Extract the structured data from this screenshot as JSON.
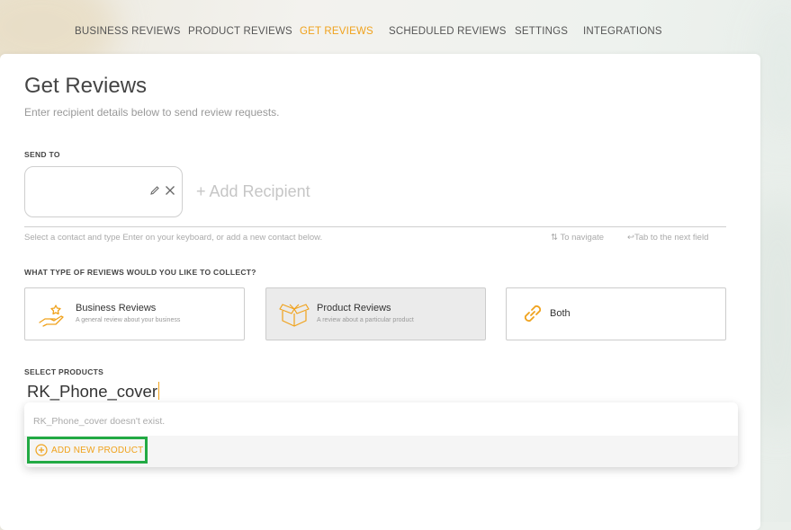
{
  "nav": {
    "items": [
      {
        "label": "BUSINESS REVIEWS",
        "active": false
      },
      {
        "label": "PRODUCT REVIEWS",
        "active": false
      },
      {
        "label": "GET REVIEWS",
        "active": true
      },
      {
        "label": "SCHEDULED REVIEWS",
        "active": false
      },
      {
        "label": "SETTINGS",
        "active": false
      },
      {
        "label": "INTEGRATIONS",
        "active": false
      }
    ]
  },
  "page": {
    "title": "Get Reviews",
    "subtitle": "Enter recipient details below to send review requests."
  },
  "send_to": {
    "label": "SEND TO",
    "add_recipient": "+ Add Recipient",
    "hint_left": "Select a contact and type Enter on your keyboard, or add a new contact below.",
    "hint_navigate": "To navigate",
    "hint_tab": "Tab to the next field"
  },
  "review_type": {
    "label": "WHAT TYPE OF REVIEWS WOULD YOU LIKE TO COLLECT?",
    "options": [
      {
        "title": "Business Reviews",
        "desc": "A general review about your business",
        "icon": "hand-star-icon",
        "selected": false
      },
      {
        "title": "Product Reviews",
        "desc": "A review about a particular product",
        "icon": "box-icon",
        "selected": true
      },
      {
        "title": "Both",
        "desc": "",
        "icon": "link-icon",
        "selected": false
      }
    ]
  },
  "products": {
    "label": "SELECT PRODUCTS",
    "input_value": "RK_Phone_cover",
    "not_found": "RK_Phone_cover doesn't exist.",
    "add_new": "ADD NEW PRODUCT"
  },
  "colors": {
    "accent": "#f0a21c",
    "highlight": "#22aa44"
  }
}
